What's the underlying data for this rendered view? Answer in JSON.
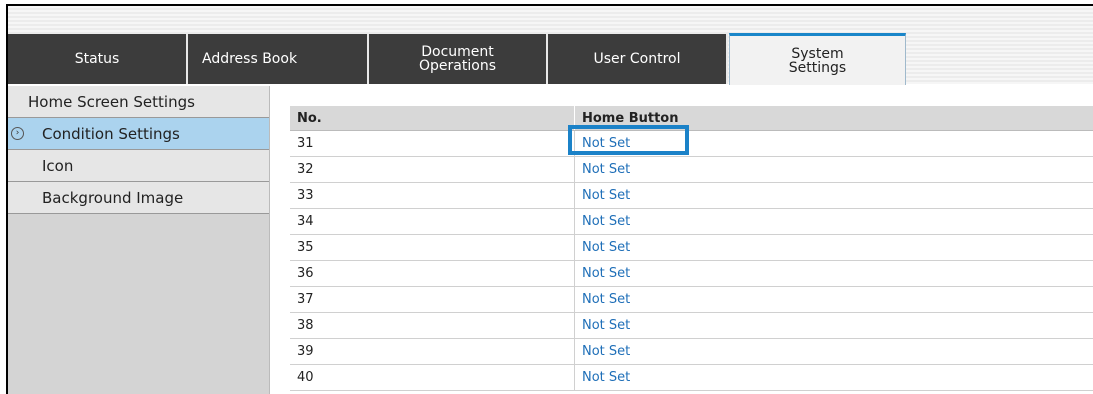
{
  "tabs": [
    {
      "label": "Status"
    },
    {
      "label": "Address Book"
    },
    {
      "label": "Document\nOperations"
    },
    {
      "label": "User Control"
    },
    {
      "label": "System\nSettings"
    }
  ],
  "sidebar": {
    "items": [
      {
        "label": "Home Screen Settings"
      },
      {
        "label": "Condition Settings"
      },
      {
        "label": "Icon"
      },
      {
        "label": "Background Image"
      }
    ]
  },
  "table": {
    "headers": [
      "No.",
      "Home Button"
    ],
    "rows": [
      {
        "no": "31",
        "value": "Not Set"
      },
      {
        "no": "32",
        "value": "Not Set"
      },
      {
        "no": "33",
        "value": "Not Set"
      },
      {
        "no": "34",
        "value": "Not Set"
      },
      {
        "no": "35",
        "value": "Not Set"
      },
      {
        "no": "36",
        "value": "Not Set"
      },
      {
        "no": "37",
        "value": "Not Set"
      },
      {
        "no": "38",
        "value": "Not Set"
      },
      {
        "no": "39",
        "value": "Not Set"
      },
      {
        "no": "40",
        "value": "Not Set"
      }
    ]
  },
  "colors": {
    "tab_dark": "#3c3c3c",
    "active_tab_accent": "#1a86c9",
    "selected_sidebar": "#abd3ee",
    "link": "#1f6fb8",
    "highlight_box": "#1b82c8"
  }
}
